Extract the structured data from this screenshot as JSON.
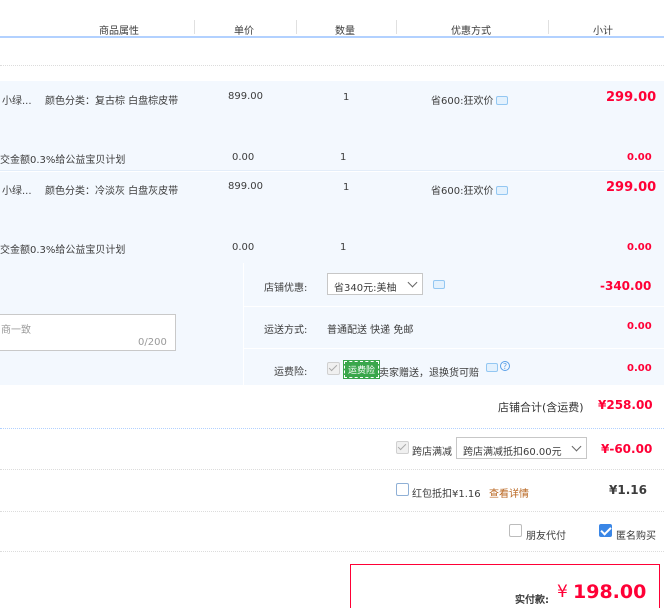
{
  "header": {
    "columns": [
      "商品属性",
      "单价",
      "数量",
      "优惠方式",
      "小计"
    ]
  },
  "items": [
    {
      "name": "小绿...",
      "attr": "颜色分类：复古棕 白盘棕皮带",
      "price": "899.00",
      "qty": "1",
      "promo": "省600:狂欢价",
      "subtotal": "299.00",
      "charity_label": "交金额0.3%给公益宝贝计划",
      "charity_price": "0.00",
      "charity_qty": "1",
      "charity_subtotal": "0.00"
    },
    {
      "name": "小绿...",
      "attr": "颜色分类：冷淡灰 白盘灰皮带",
      "price": "899.00",
      "qty": "1",
      "promo": "省600:狂欢价",
      "subtotal": "299.00",
      "charity_label": "交金额0.3%给公益宝贝计划",
      "charity_price": "0.00",
      "charity_qty": "1",
      "charity_subtotal": "0.00"
    }
  ],
  "shop": {
    "discount_label": "店铺优惠:",
    "discount_select": "省340元:美柚",
    "discount_value": "-340.00",
    "shipping_label": "运送方式:",
    "shipping_value": "普通配送 快递 免邮",
    "shipping_amount": "0.00",
    "insurance_label": "运费险:",
    "insurance_tag": "运费险",
    "insurance_text": "卖家赠送，退换货可赔",
    "insurance_amount": "0.00",
    "message_placeholder": "商一致",
    "message_count": "0/200",
    "total_label": "店铺合计(含运费)",
    "total_value": "¥258.00"
  },
  "cross_shop": {
    "label": "跨店满减",
    "select": "跨店满减抵扣60.00元",
    "value": "¥-60.00"
  },
  "redpacket": {
    "label": "红包抵扣¥1.16",
    "link": "查看详情",
    "value": "¥1.16"
  },
  "options": {
    "friend_pay": "朋友代付",
    "anonymous": "匿名购买"
  },
  "payment": {
    "label": "实付款:",
    "currency": "¥",
    "amount": "198.00"
  }
}
